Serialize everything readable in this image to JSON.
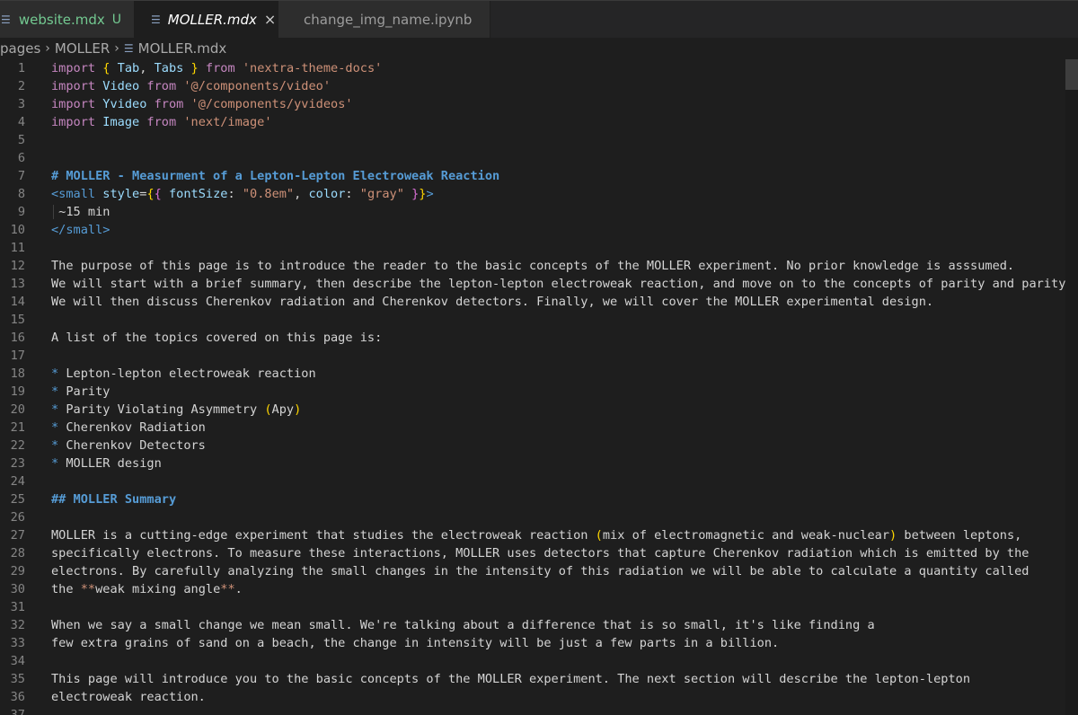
{
  "tabs": [
    {
      "label": "website.mdx",
      "status": "U"
    },
    {
      "label": "MOLLER.mdx",
      "close": "×"
    },
    {
      "label": "change_img_name.ipynb"
    }
  ],
  "breadcrumb": {
    "part1": "pages",
    "part2": "MOLLER",
    "file": "MOLLER.mdx"
  },
  "lines": [
    {
      "n": "1",
      "parts": [
        {
          "c": "kw",
          "t": "import "
        },
        {
          "c": "br1",
          "t": "{ "
        },
        {
          "c": "id",
          "t": "Tab"
        },
        {
          "c": "",
          "t": ", "
        },
        {
          "c": "id",
          "t": "Tabs"
        },
        {
          "c": "br1",
          "t": " }"
        },
        {
          "c": "kw",
          "t": " from "
        },
        {
          "c": "str",
          "t": "'nextra-theme-docs'"
        }
      ]
    },
    {
      "n": "2",
      "parts": [
        {
          "c": "kw",
          "t": "import "
        },
        {
          "c": "id",
          "t": "Video"
        },
        {
          "c": "kw",
          "t": " from "
        },
        {
          "c": "str",
          "t": "'@/components/video'"
        }
      ]
    },
    {
      "n": "3",
      "parts": [
        {
          "c": "kw",
          "t": "import "
        },
        {
          "c": "id",
          "t": "Yvideo"
        },
        {
          "c": "kw",
          "t": " from "
        },
        {
          "c": "str",
          "t": "'@/components/yvideos'"
        }
      ]
    },
    {
      "n": "4",
      "parts": [
        {
          "c": "kw",
          "t": "import "
        },
        {
          "c": "id",
          "t": "Image"
        },
        {
          "c": "kw",
          "t": " from "
        },
        {
          "c": "str",
          "t": "'next/image'"
        }
      ]
    },
    {
      "n": "5",
      "parts": []
    },
    {
      "n": "6",
      "parts": []
    },
    {
      "n": "7",
      "parts": [
        {
          "c": "head",
          "t": "# MOLLER - Measurment of a Lepton-Lepton Electroweak Reaction"
        }
      ]
    },
    {
      "n": "8",
      "parts": [
        {
          "c": "tag",
          "t": "<small "
        },
        {
          "c": "id",
          "t": "style"
        },
        {
          "c": "",
          "t": "="
        },
        {
          "c": "br1",
          "t": "{"
        },
        {
          "c": "br2",
          "t": "{ "
        },
        {
          "c": "id",
          "t": "fontSize"
        },
        {
          "c": "",
          "t": ": "
        },
        {
          "c": "str",
          "t": "\"0.8em\""
        },
        {
          "c": "",
          "t": ", "
        },
        {
          "c": "id",
          "t": "color"
        },
        {
          "c": "",
          "t": ": "
        },
        {
          "c": "str",
          "t": "\"gray\""
        },
        {
          "c": "br2",
          "t": " }"
        },
        {
          "c": "br1",
          "t": "}"
        },
        {
          "c": "tag",
          "t": ">"
        }
      ]
    },
    {
      "n": "9",
      "guide": true,
      "parts": [
        {
          "c": "",
          "t": " ~15 min"
        }
      ]
    },
    {
      "n": "10",
      "parts": [
        {
          "c": "tag",
          "t": "</small>"
        }
      ]
    },
    {
      "n": "11",
      "parts": []
    },
    {
      "n": "12",
      "parts": [
        {
          "c": "",
          "t": "The purpose of this page is to introduce the reader to the basic concepts of the MOLLER experiment. No prior knowledge is asssumed."
        }
      ]
    },
    {
      "n": "13",
      "parts": [
        {
          "c": "",
          "t": "We will start with a brief summary, then describe the lepton-lepton electroweak reaction, and move on to the concepts of parity and parity vio"
        }
      ]
    },
    {
      "n": "14",
      "parts": [
        {
          "c": "",
          "t": "We will then discuss Cherenkov radiation and Cherenkov detectors. Finally, we will cover the MOLLER experimental design."
        }
      ]
    },
    {
      "n": "15",
      "parts": []
    },
    {
      "n": "16",
      "parts": [
        {
          "c": "",
          "t": "A list of the topics covered on this page is:"
        }
      ]
    },
    {
      "n": "17",
      "parts": []
    },
    {
      "n": "18",
      "parts": [
        {
          "c": "tag",
          "t": "*"
        },
        {
          "c": "",
          "t": " Lepton-lepton electroweak reaction"
        }
      ]
    },
    {
      "n": "19",
      "parts": [
        {
          "c": "tag",
          "t": "*"
        },
        {
          "c": "",
          "t": " Parity"
        }
      ]
    },
    {
      "n": "20",
      "parts": [
        {
          "c": "tag",
          "t": "*"
        },
        {
          "c": "",
          "t": " Parity Violating Asymmetry "
        },
        {
          "c": "br1",
          "t": "("
        },
        {
          "c": "",
          "t": "Apy"
        },
        {
          "c": "br1",
          "t": ")"
        }
      ]
    },
    {
      "n": "21",
      "parts": [
        {
          "c": "tag",
          "t": "*"
        },
        {
          "c": "",
          "t": " Cherenkov Radiation"
        }
      ]
    },
    {
      "n": "22",
      "parts": [
        {
          "c": "tag",
          "t": "*"
        },
        {
          "c": "",
          "t": " Cherenkov Detectors"
        }
      ]
    },
    {
      "n": "23",
      "parts": [
        {
          "c": "tag",
          "t": "*"
        },
        {
          "c": "",
          "t": " MOLLER design"
        }
      ]
    },
    {
      "n": "24",
      "parts": []
    },
    {
      "n": "25",
      "parts": [
        {
          "c": "head",
          "t": "## MOLLER Summary"
        }
      ]
    },
    {
      "n": "26",
      "parts": []
    },
    {
      "n": "27",
      "parts": [
        {
          "c": "",
          "t": "MOLLER is a cutting-edge experiment that studies the electroweak reaction "
        },
        {
          "c": "br1",
          "t": "("
        },
        {
          "c": "",
          "t": "mix of electromagnetic and weak-nuclear"
        },
        {
          "c": "br1",
          "t": ")"
        },
        {
          "c": "",
          "t": " between leptons,"
        }
      ]
    },
    {
      "n": "28",
      "parts": [
        {
          "c": "",
          "t": "specifically electrons. To measure these interactions, MOLLER uses detectors that capture Cherenkov radiation which is emitted by the"
        }
      ]
    },
    {
      "n": "29",
      "parts": [
        {
          "c": "",
          "t": "electrons. By carefully analyzing the small changes in the intensity of this radiation we will be able to calculate a quantity called"
        }
      ]
    },
    {
      "n": "30",
      "parts": [
        {
          "c": "",
          "t": "the "
        },
        {
          "c": "strong",
          "t": "**"
        },
        {
          "c": "",
          "t": "weak mixing angle"
        },
        {
          "c": "strong",
          "t": "**"
        },
        {
          "c": "",
          "t": "."
        }
      ]
    },
    {
      "n": "31",
      "parts": []
    },
    {
      "n": "32",
      "parts": [
        {
          "c": "",
          "t": "When we say a small change we mean small. We're talking about a difference that is so small, it's like finding a"
        }
      ]
    },
    {
      "n": "33",
      "parts": [
        {
          "c": "",
          "t": "few extra grains of sand on a beach, the change in intensity will be just a few parts in a billion."
        }
      ]
    },
    {
      "n": "34",
      "parts": []
    },
    {
      "n": "35",
      "parts": [
        {
          "c": "",
          "t": "This page will introduce you to the basic concepts of the MOLLER experiment. The next section will describe the lepton-lepton"
        }
      ]
    },
    {
      "n": "36",
      "parts": [
        {
          "c": "",
          "t": "electroweak reaction."
        }
      ]
    },
    {
      "n": "37",
      "parts": []
    }
  ]
}
